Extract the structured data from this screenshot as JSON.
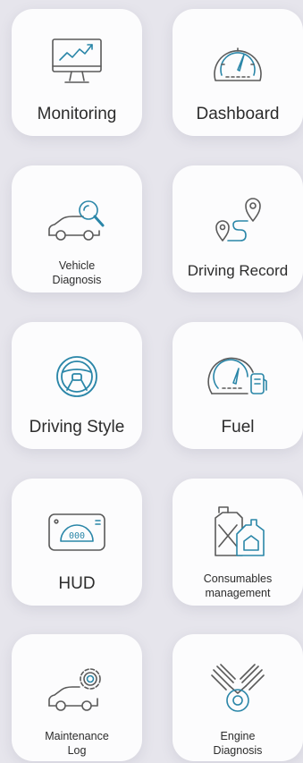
{
  "colors": {
    "background": "#e6e5ec",
    "tile": "#fcfcfd",
    "icon_gray": "#5a5a5a",
    "icon_accent": "#2a86a8"
  },
  "tiles": [
    {
      "label": "Monitoring",
      "icon": "monitor-chart-icon"
    },
    {
      "label": "Dashboard",
      "icon": "speedometer-icon"
    },
    {
      "label": "Vehicle\nDiagnosis",
      "icon": "car-magnifier-icon"
    },
    {
      "label": "Driving Record",
      "icon": "route-pins-icon"
    },
    {
      "label": "Driving Style",
      "icon": "steering-wheel-icon"
    },
    {
      "label": "Fuel",
      "icon": "gauge-fuel-pump-icon"
    },
    {
      "label": "HUD",
      "icon": "hud-display-icon"
    },
    {
      "label": "Consumables\nmanagement",
      "icon": "oil-cans-icon"
    },
    {
      "label": "Maintenance\nLog",
      "icon": "car-gear-icon"
    },
    {
      "label": "Engine\nDiagnosis",
      "icon": "engine-icon"
    }
  ]
}
